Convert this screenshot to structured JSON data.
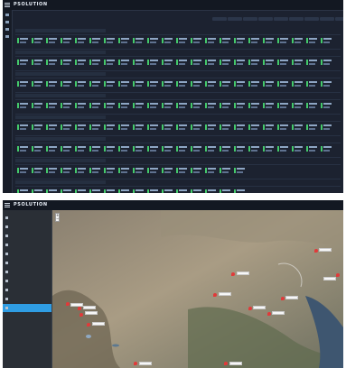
{
  "top_screen": {
    "header": {
      "brand": "PSOLUTION",
      "title": ""
    },
    "summary_label": "",
    "summary_stats": [
      {
        "value": "",
        "label": ""
      },
      {
        "value": "",
        "label": ""
      },
      {
        "value": "",
        "label": ""
      },
      {
        "value": "",
        "label": ""
      },
      {
        "value": "",
        "label": ""
      },
      {
        "value": "",
        "label": ""
      }
    ],
    "filter_chips": [
      "",
      "",
      "",
      "",
      "",
      "",
      "",
      "",
      ""
    ],
    "groups": [
      {
        "label": "",
        "cells": 22
      },
      {
        "label": "",
        "cells": 22
      },
      {
        "label": "",
        "cells": 22
      },
      {
        "label": "",
        "cells": 22
      },
      {
        "label": "",
        "cells": 22
      },
      {
        "label": "",
        "cells": 22
      },
      {
        "label": "",
        "cells": 16
      },
      {
        "label": "",
        "cells": 16
      }
    ]
  },
  "bottom_screen": {
    "header": {
      "brand": "PSOLUTION",
      "title": "",
      "user": ""
    },
    "nav_items": [
      "",
      "",
      "",
      "",
      "",
      "",
      "",
      "",
      "",
      "",
      ""
    ],
    "active_nav_index": 10,
    "map": {
      "zoom_in": "+",
      "zoom_out": "−",
      "markers": [
        "",
        "",
        "",
        "",
        "",
        "",
        "",
        "",
        "",
        "",
        "",
        "",
        ""
      ]
    }
  }
}
